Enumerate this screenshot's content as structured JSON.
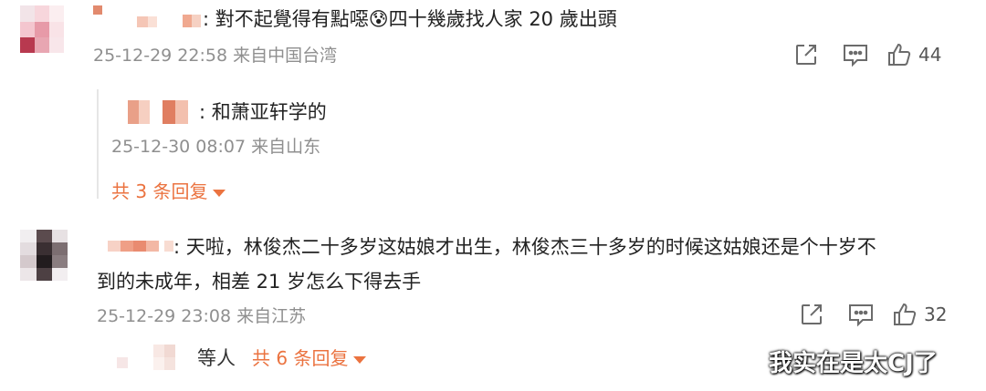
{
  "comments": [
    {
      "text": ": 對不起覺得有點噁😰四十幾歲找人家 20 歲出頭",
      "meta": "25-12-29 22:58 来自中国台湾",
      "likes": "44",
      "reply": {
        "text": ": 和萧亚轩学的",
        "meta": "25-12-30 08:07 来自山东"
      },
      "more_replies": "共 3 条回复"
    },
    {
      "text_line1": ": 天啦，林俊杰二十多岁这姑娘才出生，林俊杰三十多岁的时候这姑娘还是个十岁不",
      "text_line2": "到的未成年，相差 21 岁怎么下得去手",
      "meta": "25-12-29 23:08 来自江苏",
      "likes": "32",
      "others_prefix": "等人",
      "more_replies": "共 6 条回复"
    }
  ],
  "watermark": "我实在是太CJ了",
  "icons": {
    "share": "share-icon",
    "comment": "comment-icon",
    "like": "thumbs-up-icon",
    "expand": "caret-down-icon"
  },
  "colors": {
    "link": "#eb7340",
    "meta": "#8f8f8f",
    "text": "#222222"
  }
}
